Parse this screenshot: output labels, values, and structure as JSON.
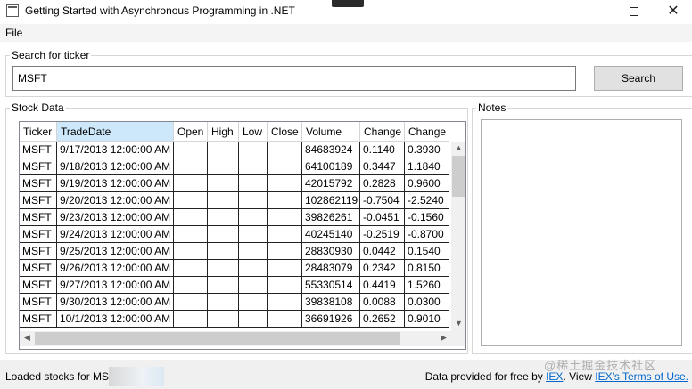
{
  "window": {
    "title": "Getting Started with Asynchronous Programming in .NET",
    "min_glyph": "",
    "max_glyph": "",
    "close_glyph": "✕"
  },
  "menu": {
    "file": "File"
  },
  "search": {
    "group_label": "Search for ticker",
    "value": "MSFT",
    "button_label": "Search"
  },
  "stock": {
    "group_label": "Stock Data",
    "columns": [
      "Ticker",
      "TradeDate",
      "Open",
      "High",
      "Low",
      "Close",
      "Volume",
      "Change",
      "Change"
    ],
    "rows": [
      [
        "MSFT",
        "9/17/2013 12:00:00 AM",
        "",
        "",
        "",
        "",
        "84683924",
        "0.1140",
        "0.3930"
      ],
      [
        "MSFT",
        "9/18/2013 12:00:00 AM",
        "",
        "",
        "",
        "",
        "64100189",
        "0.3447",
        "1.1840"
      ],
      [
        "MSFT",
        "9/19/2013 12:00:00 AM",
        "",
        "",
        "",
        "",
        "42015792",
        "0.2828",
        "0.9600"
      ],
      [
        "MSFT",
        "9/20/2013 12:00:00 AM",
        "",
        "",
        "",
        "",
        "102862119",
        "-0.7504",
        "-2.5240"
      ],
      [
        "MSFT",
        "9/23/2013 12:00:00 AM",
        "",
        "",
        "",
        "",
        "39826261",
        "-0.0451",
        "-0.1560"
      ],
      [
        "MSFT",
        "9/24/2013 12:00:00 AM",
        "",
        "",
        "",
        "",
        "40245140",
        "-0.2519",
        "-0.8700"
      ],
      [
        "MSFT",
        "9/25/2013 12:00:00 AM",
        "",
        "",
        "",
        "",
        "28830930",
        "0.0442",
        "0.1540"
      ],
      [
        "MSFT",
        "9/26/2013 12:00:00 AM",
        "",
        "",
        "",
        "",
        "28483079",
        "0.2342",
        "0.8150"
      ],
      [
        "MSFT",
        "9/27/2013 12:00:00 AM",
        "",
        "",
        "",
        "",
        "55330514",
        "0.4419",
        "1.5260"
      ],
      [
        "MSFT",
        "9/30/2013 12:00:00 AM",
        "",
        "",
        "",
        "",
        "39838108",
        "0.0088",
        "0.0300"
      ],
      [
        "MSFT",
        "10/1/2013 12:00:00 AM",
        "",
        "",
        "",
        "",
        "36691926",
        "0.2652",
        "0.9010"
      ]
    ]
  },
  "notes": {
    "group_label": "Notes"
  },
  "status": {
    "left_text": "Loaded stocks for MSI",
    "right_prefix": "Data provided for free by ",
    "iex_link": "IEX",
    "view_text": ". View ",
    "terms_link": "IEX's Terms of Use."
  },
  "watermark": "@稀土掘金技术社区",
  "colors": {
    "sorted_header": "#cde8fb",
    "link": "#0066cc"
  }
}
